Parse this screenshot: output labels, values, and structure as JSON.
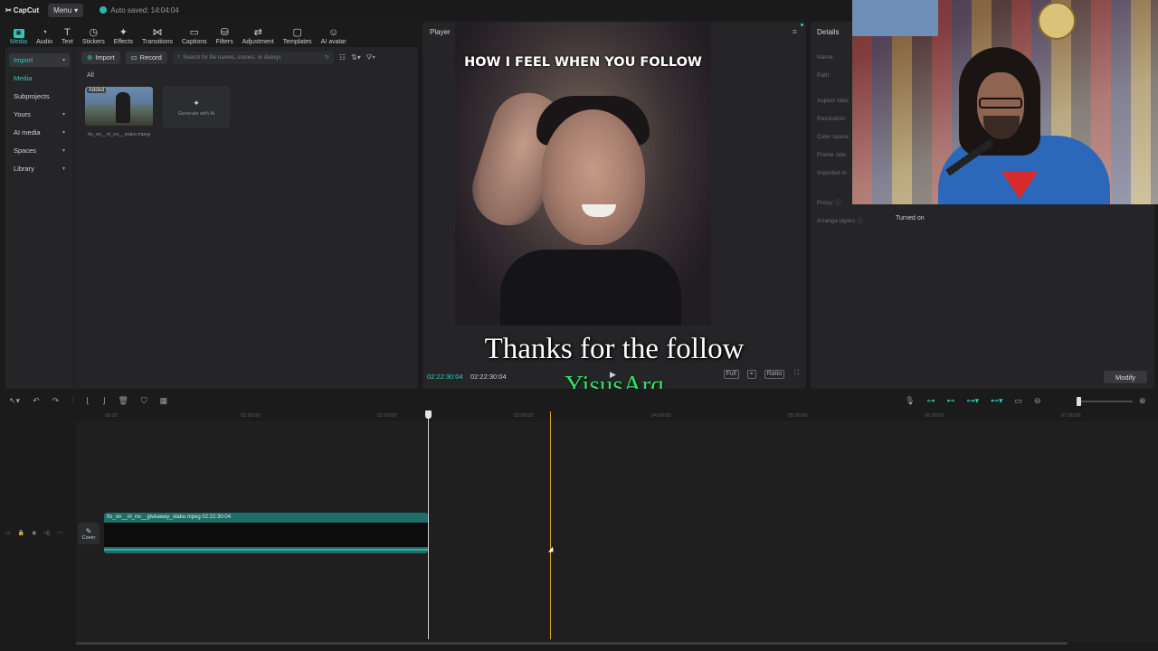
{
  "titlebar": {
    "app_name": "CapCut",
    "menu_label": "Menu",
    "autosave_text": "Auto saved: 14:04:04"
  },
  "toolbar": {
    "items": [
      {
        "label": "Media",
        "icon": "media-icon"
      },
      {
        "label": "Audio",
        "icon": "audio-icon"
      },
      {
        "label": "Text",
        "icon": "text-icon"
      },
      {
        "label": "Stickers",
        "icon": "stickers-icon"
      },
      {
        "label": "Effects",
        "icon": "effects-icon"
      },
      {
        "label": "Transitions",
        "icon": "transitions-icon"
      },
      {
        "label": "Captions",
        "icon": "captions-icon"
      },
      {
        "label": "Filters",
        "icon": "filters-icon"
      },
      {
        "label": "Adjustment",
        "icon": "adjustment-icon"
      },
      {
        "label": "Templates",
        "icon": "templates-icon"
      },
      {
        "label": "AI avatar",
        "icon": "ai-avatar-icon"
      }
    ],
    "active": "Media"
  },
  "sidebar": {
    "items": [
      {
        "label": "Import"
      },
      {
        "label": "Media"
      },
      {
        "label": "Subprojects"
      },
      {
        "label": "Yours"
      },
      {
        "label": "AI media"
      },
      {
        "label": "Spaces"
      },
      {
        "label": "Library"
      }
    ]
  },
  "media": {
    "import_label": "Import",
    "record_label": "Record",
    "search_placeholder": "Search for file names, scenes, or dialogs",
    "filter_all": "All",
    "thumb_badge": "Added",
    "thumb_name": "tts_on__irl_no__stake.mpeg",
    "generate_label": "Generate with AI"
  },
  "player": {
    "title": "Player",
    "video_caption": "HOW I FEEL WHEN YOU FOLLOW",
    "overlay_text": "Thanks for the follow",
    "follower_name": "YisusArq",
    "time_current": "02:22:30:04",
    "time_total": "02:22:30:04",
    "ctrl_full": "Full",
    "ctrl_ratio": "Ratio"
  },
  "details": {
    "title": "Details",
    "rows": [
      "Name:",
      "Path:",
      "Aspect ratio:",
      "Resolution:",
      "Color space:",
      "Frame rate:",
      "Imported m"
    ],
    "proxy_label": "Proxy:",
    "arrange_label": "Arrange layers",
    "arrange_value": "Turned on",
    "modify_label": "Modify"
  },
  "timeline": {
    "ruler": [
      "00:00",
      "01:00:00",
      "02:00:00",
      "03:00:00",
      "04:00:00",
      "05:00:00",
      "06:00:00",
      "07:00:00"
    ],
    "cover_label": "Cover",
    "clip_label": "tts_on__irl_no__giveaway_stake.mpeg   02:22:30:04"
  }
}
